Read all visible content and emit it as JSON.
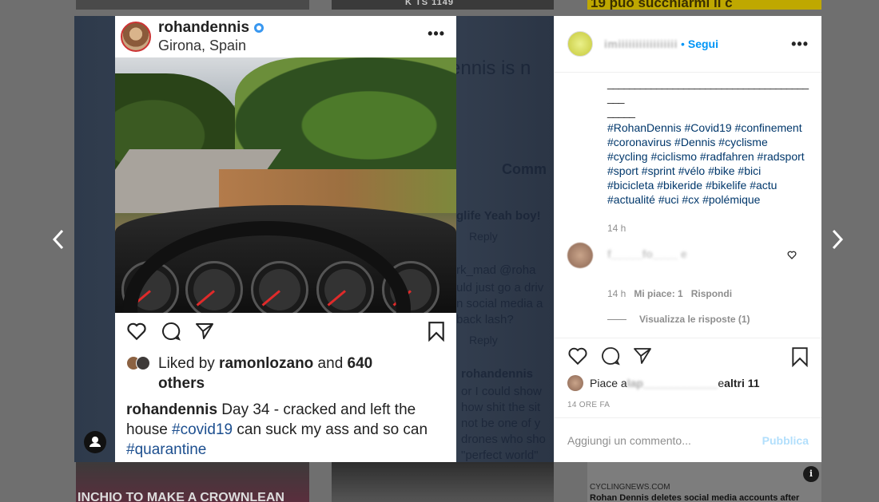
{
  "background": {
    "top_middle_plate": "K TS 1149",
    "top_right_text": "19 può succhiarmi il c",
    "bottom_left_text": "INCHIO TO MAKE A CROWNLEAN",
    "bottom_right_source": "CYCLINGNEWS.COM",
    "bottom_right_headline": "Rohan Dennis deletes social media accounts after"
  },
  "post_image": {
    "ghost_texts": [
      "ennis is n",
      "Comm",
      "glife Yeah boy!",
      "Reply",
      "rk_mad @roha",
      "uld just go a driv",
      "n social media a",
      "back lash?",
      "Reply",
      "rohandennis",
      "or I could show",
      "how shit the sit",
      "not be one of y",
      "drones who sho",
      "\"perfect world\""
    ],
    "screenshot": {
      "username": "rohandennis",
      "location": "Girona, Spain",
      "liked_by_prefix": "Liked by ",
      "liked_by_user": "ramonlozano",
      "liked_by_mid": " and ",
      "liked_by_count": "640",
      "liked_by_suffix": "others",
      "caption_user": "rohandennis",
      "caption_text_1": " Day 34 - cracked and left the house ",
      "caption_tag_1": "#covid19",
      "caption_text_2": " can suck my ass and so can ",
      "caption_tag_2": "#quarantine"
    }
  },
  "side": {
    "username": "imiiiiiiiiiiiiiiiii",
    "dot": "•",
    "follow_label": "Segui",
    "rule": "________________________________________",
    "rule_2": "_____",
    "hashtags": "#RohanDennis #Covid19 #confinement #coronavirus #Dennis #cyclisme #cycling #ciclismo #radfahren #radsport #sport #sprint #vélo #bike #bici #bicicleta #bikeride #bikelife #actu #actualité #uci #cx #polémique",
    "post_time": "14 h",
    "comment": {
      "text": "f_____fo____ e",
      "time": "14 h",
      "likes": "Mi piace: 1",
      "reply": "Rispondi",
      "view_replies": "Visualizza le risposte (1)"
    },
    "likes_prefix": "Piace a ",
    "likes_name": "lap____________",
    "likes_suffix": " e ",
    "likes_others": "altri 11",
    "time_ago": "14 ORE FA",
    "comment_placeholder": "Aggiungi un commento...",
    "publish_label": "Pubblica"
  }
}
